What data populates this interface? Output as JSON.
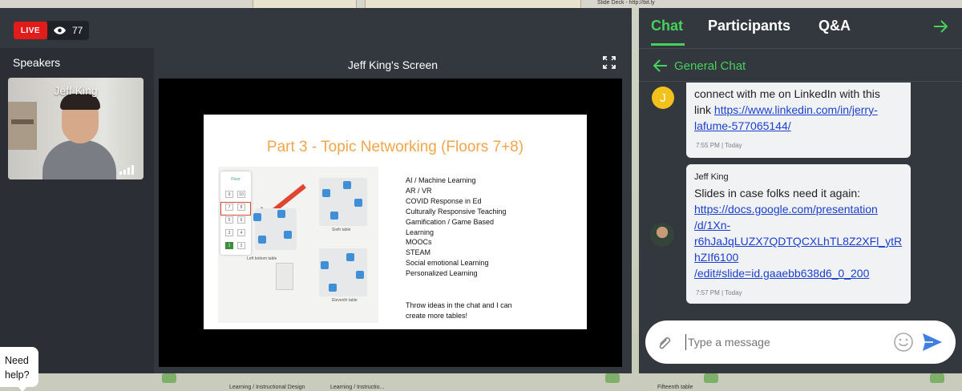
{
  "background": {
    "top_note": "Slide Deck - http://bit.ly",
    "bottom_labels": [
      "Learning / Instructional Design",
      "Learning / Instructio...",
      "Fifteenth table"
    ]
  },
  "stage": {
    "live_label": "LIVE",
    "viewer_count": "77",
    "speakers_title": "Speakers",
    "speaker_name": "Jeff King",
    "screen_title": "Jeff King's Screen"
  },
  "slide": {
    "title": "Part 3 - Topic Networking (Floors 7+8)",
    "floor_label": "Floor",
    "floor_cells": [
      "9",
      "10",
      "7",
      "8",
      "5",
      "6",
      "3",
      "4",
      "1",
      "2"
    ],
    "map_labels": [
      "Sixth table",
      "Left bottom table",
      "Eleventh table"
    ],
    "topics": [
      "AI / Machine Learning",
      "AR / VR",
      "COVID Response in Ed",
      "Culturally Responsive Teaching",
      "Gamification / Game Based",
      "Learning",
      "MOOCs",
      "STEAM",
      "Social emotional Learning",
      "Personalized Learning"
    ],
    "footer_line1": "Throw ideas in the chat and I can",
    "footer_line2": "create more tables!"
  },
  "chat": {
    "tabs": [
      "Chat",
      "Participants",
      "Q&A"
    ],
    "sub_label": "General Chat",
    "messages": [
      {
        "avatar_letter": "J",
        "line1": "connect with me on LinkedIn with this",
        "link_prefix": "link ",
        "link": "https://www.linkedin.com/in/jerry-",
        "link2": "lafume-577065144/",
        "time": "7:55 PM | Today"
      },
      {
        "author": "Jeff King",
        "text": "Slides in case folks need it again:",
        "link_lines": [
          "https://docs.google.com/presentation",
          "/d/1Xn-",
          "r6hJaJqLUZX7QDTQCXLhTL8Z2XFl_ytR",
          "hZIf6100",
          "/edit#slide=id.gaaebb638d6_0_200"
        ],
        "time": "7:57 PM | Today"
      }
    ],
    "input_placeholder": "Type a message"
  },
  "help": {
    "line1": "Need",
    "line2": "help?"
  },
  "colors": {
    "accent_green": "#46d15a",
    "live_red": "#e21b1b",
    "panel_dark": "#33373e",
    "slide_title_orange": "#f2a64a",
    "link_blue": "#1a3fd0",
    "send_blue": "#3f7fe0"
  },
  "icons": [
    "eye-icon",
    "fullscreen-icon",
    "signal-icon",
    "arrow-right-icon",
    "arrow-left-icon",
    "paperclip-icon",
    "emoji-icon",
    "send-icon"
  ]
}
